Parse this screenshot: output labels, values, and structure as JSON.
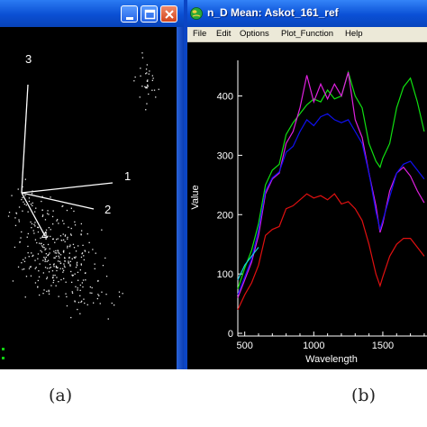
{
  "panel_a": {
    "caption": "(a)",
    "axis_labels": [
      "3",
      "1",
      "2",
      "4"
    ]
  },
  "panel_b": {
    "caption": "(b)",
    "window_title": "n_D Mean: Askot_161_ref",
    "icon": "idl-globe-icon",
    "menu": [
      "File",
      "Edit",
      "Options",
      "Plot_Function",
      "Help"
    ],
    "colors": {
      "red": "#e01010",
      "magenta": "#e020e0",
      "blue": "#1010f0",
      "green": "#10e010",
      "cyan": "#10d0e0",
      "axis": "#ffffff",
      "background": "#000000"
    }
  },
  "chart_data": {
    "type": "line",
    "xlabel": "Wavelength",
    "ylabel": "Value",
    "xlim": [
      450,
      1820
    ],
    "ylim": [
      0,
      460
    ],
    "xticks": [
      500,
      1000,
      1500
    ],
    "xtick_labels": [
      "500",
      "1000",
      "1500",
      "1"
    ],
    "yticks": [
      0,
      100,
      200,
      300,
      400
    ],
    "ytick_labels": [
      "0",
      "100",
      "200",
      "300",
      "400"
    ],
    "series": [
      {
        "color": "green",
        "x": [
          450,
          500,
          550,
          600,
          650,
          700,
          750,
          800,
          850,
          900,
          950,
          1000,
          1050,
          1100,
          1150,
          1200,
          1250,
          1300,
          1350,
          1400,
          1450,
          1480,
          1500,
          1550,
          1600,
          1650,
          1700,
          1750,
          1800
        ],
        "y": [
          75,
          110,
          140,
          185,
          250,
          275,
          285,
          335,
          355,
          370,
          385,
          395,
          390,
          410,
          395,
          400,
          440,
          400,
          380,
          320,
          290,
          280,
          295,
          320,
          380,
          415,
          430,
          390,
          340
        ]
      },
      {
        "color": "magenta",
        "x": [
          450,
          500,
          550,
          600,
          650,
          700,
          750,
          800,
          850,
          900,
          950,
          1000,
          1050,
          1100,
          1150,
          1200,
          1250,
          1300,
          1350,
          1400,
          1450,
          1480,
          1500,
          1550,
          1600,
          1650,
          1700,
          1750,
          1800
        ],
        "y": [
          60,
          90,
          120,
          165,
          235,
          260,
          270,
          320,
          340,
          380,
          435,
          390,
          420,
          395,
          420,
          400,
          440,
          360,
          330,
          270,
          215,
          170,
          185,
          240,
          270,
          280,
          265,
          240,
          220
        ]
      },
      {
        "color": "blue",
        "x": [
          450,
          500,
          550,
          600,
          650,
          700,
          750,
          800,
          850,
          900,
          950,
          1000,
          1050,
          1100,
          1150,
          1200,
          1250,
          1300,
          1350,
          1400,
          1450,
          1480,
          1500,
          1550,
          1600,
          1650,
          1700,
          1750,
          1800
        ],
        "y": [
          65,
          95,
          125,
          175,
          240,
          262,
          272,
          305,
          315,
          340,
          360,
          350,
          365,
          370,
          360,
          355,
          360,
          340,
          320,
          270,
          205,
          175,
          190,
          230,
          270,
          285,
          290,
          275,
          260
        ]
      },
      {
        "color": "red",
        "x": [
          450,
          500,
          550,
          600,
          650,
          700,
          750,
          800,
          850,
          900,
          950,
          1000,
          1050,
          1100,
          1150,
          1200,
          1250,
          1300,
          1350,
          1400,
          1450,
          1480,
          1500,
          1550,
          1600,
          1650,
          1700,
          1750,
          1800
        ],
        "y": [
          40,
          65,
          85,
          115,
          165,
          175,
          180,
          210,
          215,
          225,
          235,
          228,
          232,
          225,
          235,
          218,
          222,
          210,
          190,
          150,
          100,
          80,
          95,
          130,
          150,
          160,
          160,
          145,
          130
        ]
      },
      {
        "color": "cyan",
        "x": [
          450,
          500,
          550,
          600
        ],
        "y": [
          90,
          115,
          130,
          145
        ]
      }
    ]
  }
}
